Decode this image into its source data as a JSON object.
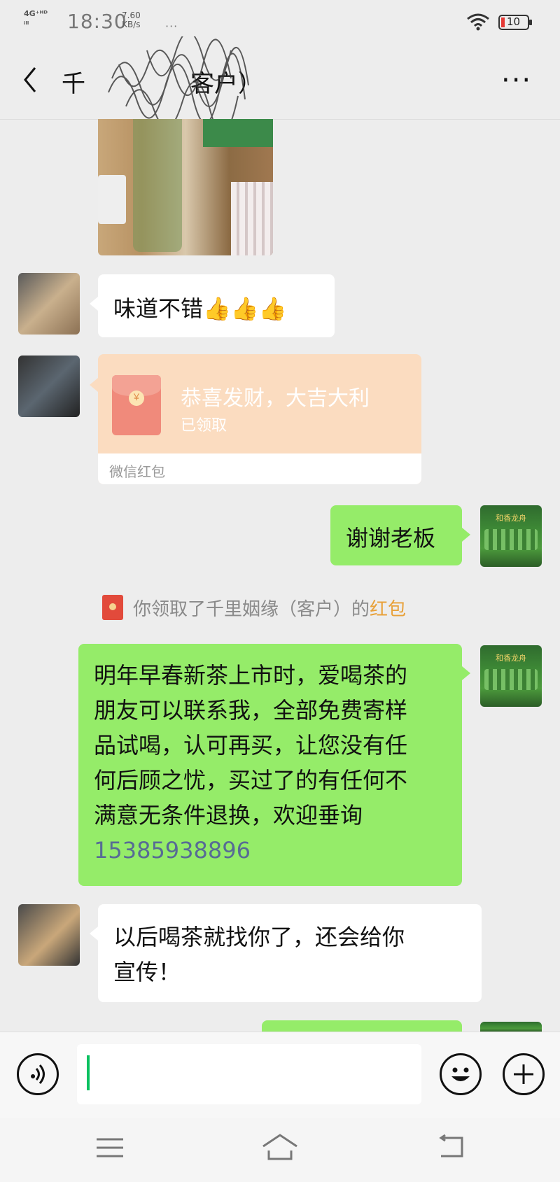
{
  "status_bar": {
    "network_top": "4G⁺ᴴᴰ",
    "network_bottom": "ᵢₗₗ",
    "time": "18:30",
    "speed_value": "7.60",
    "speed_unit": "KB/s",
    "more_dots": "···",
    "battery": "10"
  },
  "header": {
    "back_label": "<",
    "title_prefix": "千",
    "title_suffix": "客户）",
    "more_label": "···"
  },
  "messages": {
    "m1_text": "味道不错👍👍👍",
    "red_packet": {
      "title": "恭喜发财，大吉大利",
      "status": "已领取",
      "footer": "微信红包",
      "coin": "￥"
    },
    "m2_text": "谢谢老板",
    "system": {
      "text": "你领取了千里姻缘（客户）的",
      "link": "红包"
    },
    "m3_lines": [
      "明年早春新茶上市时，爱喝茶的",
      "朋友可以联系我，全部免费寄样",
      "品试喝，认可再买，让您没有任",
      "何后顾之忧，买过了的有任何不",
      "满意无条件退换，欢迎垂询"
    ],
    "m3_phone": "15385938896",
    "m4_lines": [
      "以后喝茶就找你了，还会给你",
      "宣传！"
    ],
    "tea_avatar_caption": "和香龙舟"
  },
  "colors": {
    "chat_bg": "#ededed",
    "green_bubble": "#95ec69",
    "white_bubble": "#ffffff",
    "red_packet_bg": "#fbdcc0",
    "link_orange": "#e8a13a",
    "phone_link": "#576b95",
    "caret": "#07c160"
  },
  "icons": [
    "back-icon",
    "more-icon",
    "wifi-icon",
    "battery-icon",
    "voice-icon",
    "emoji-icon",
    "plus-icon",
    "menu-icon",
    "home-icon",
    "return-icon"
  ]
}
